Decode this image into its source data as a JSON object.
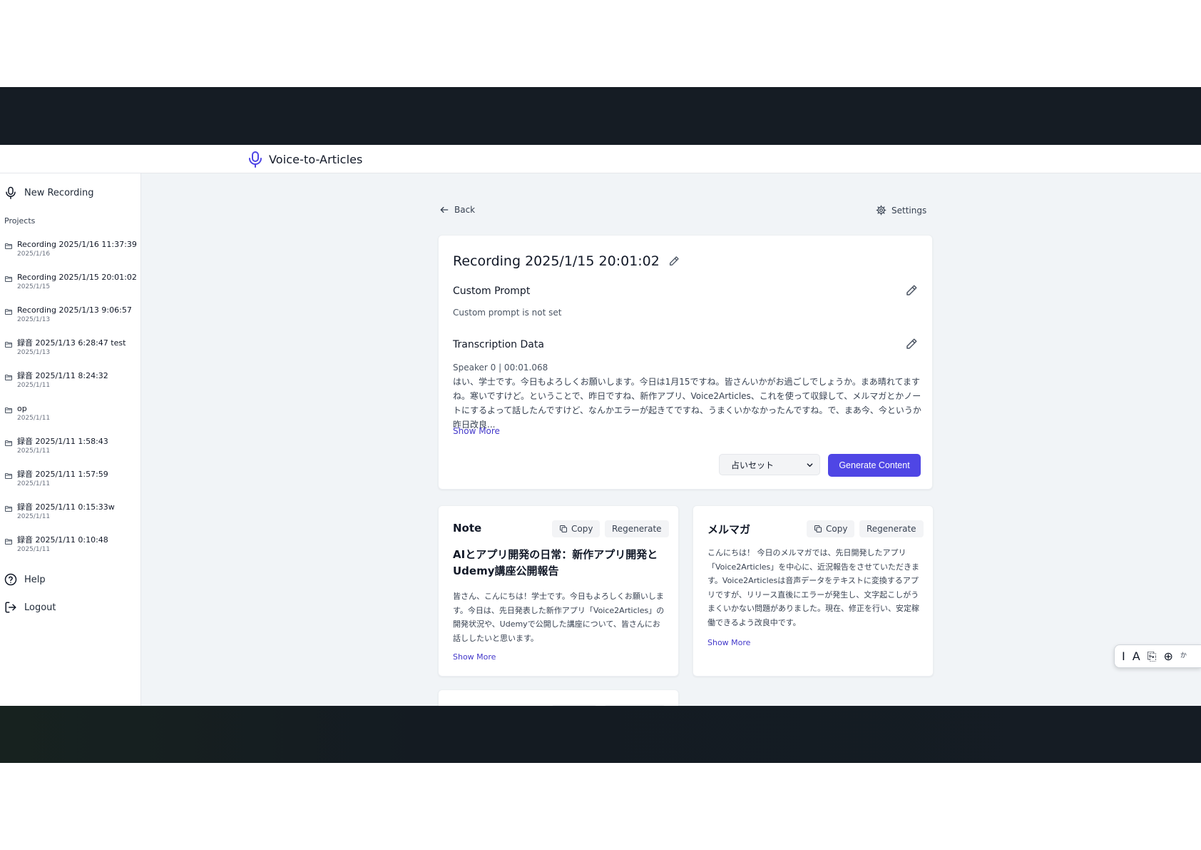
{
  "app": {
    "title": "Voice-to-Articles"
  },
  "sidebar": {
    "new_recording": "New Recording",
    "projects_label": "Projects",
    "projects": [
      {
        "name": "Recording 2025/1/16 11:37:39",
        "date": "2025/1/16"
      },
      {
        "name": "Recording 2025/1/15 20:01:02",
        "date": "2025/1/15"
      },
      {
        "name": "Recording 2025/1/13 9:06:57",
        "date": "2025/1/13"
      },
      {
        "name": "録音 2025/1/13 6:28:47 test",
        "date": "2025/1/13"
      },
      {
        "name": "録音 2025/1/11 8:24:32",
        "date": "2025/1/11"
      },
      {
        "name": "op",
        "date": "2025/1/11"
      },
      {
        "name": "録音 2025/1/11 1:58:43",
        "date": "2025/1/11"
      },
      {
        "name": "録音 2025/1/11 1:57:59",
        "date": "2025/1/11"
      },
      {
        "name": "録音 2025/1/11 0:15:33w",
        "date": "2025/1/11"
      },
      {
        "name": "録音 2025/1/11 0:10:48",
        "date": "2025/1/11"
      }
    ],
    "help": "Help",
    "logout": "Logout"
  },
  "main": {
    "back": "Back",
    "settings": "Settings",
    "recording_title": "Recording 2025/1/15 20:01:02",
    "custom_prompt": {
      "title": "Custom Prompt",
      "value": "Custom prompt is not set"
    },
    "transcription": {
      "title": "Transcription Data",
      "speaker": "Speaker 0 | 00:01.068",
      "text": "はい、学士です。今日もよろしくお願いします。今日は1月15ですね。皆さんいかがお過ごしでしょうか。まあ晴れてますね。寒いですけど。ということで、昨日ですね、新作アプリ、Voice2Articles、これを使って収録して、メルマガとかノートにするよって話したんですけど、なんかエラーが起きてですね、うまくいかなかったんですね。で、まあ今、今というか昨日改良...",
      "show_more": "Show More"
    },
    "preset": {
      "selected": "占いセット"
    },
    "generate_button": "Generate Content",
    "outputs": [
      {
        "title": "Note",
        "copy": "Copy",
        "regenerate": "Regenerate",
        "article_title": "AIとアプリ開発の日常：新作アプリ開発とUdemy講座公開報告",
        "body": "皆さん、こんにちは！学士です。今日もよろしくお願いします。今日は、先日発表した新作アプリ「Voice2Articles」の開発状況や、Udemyで公開した講座について、皆さんにお話ししたいと思います。",
        "show_more": "Show More"
      },
      {
        "title": "メルマガ",
        "copy": "Copy",
        "regenerate": "Regenerate",
        "body": "こんにちは！ 今日のメルマガでは、先日開発したアプリ「Voice2Articles」を中心に、近況報告をさせていただきます。Voice2Articlesは音声データをテキストに変換するアプリですが、リリース直後にエラーが発生し、文字起こしがうまくいかない問題がありました。現在、修正を行い、安定稼働できるよう改良中です。",
        "show_more": "Show More"
      }
    ]
  },
  "toolbar": {
    "items": [
      "I",
      "A",
      "⎘",
      "⊕"
    ],
    "peek_text": "か"
  },
  "colors": {
    "accent": "#4f46e5",
    "link": "#4338ca",
    "band": "#151c24",
    "app_bg": "#f1f4f7"
  }
}
